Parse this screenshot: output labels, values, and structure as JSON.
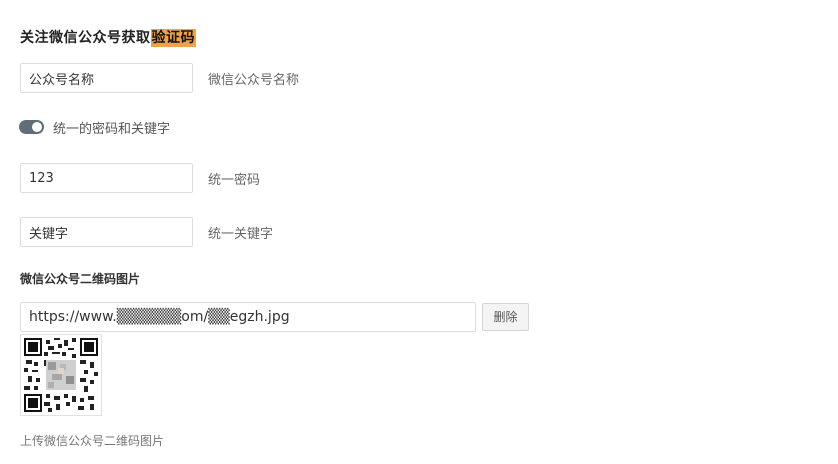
{
  "header": {
    "title_prefix": "关注微信公众号获取",
    "title_highlight": "验证码"
  },
  "fields": {
    "account_name": {
      "value": "公众号名称",
      "description": "微信公众号名称"
    },
    "unified_toggle": {
      "label": "统一的密码和关键字",
      "enabled": true
    },
    "password": {
      "value": "123",
      "description": "统一密码"
    },
    "keyword": {
      "value": "关键字",
      "description": "统一关键字"
    }
  },
  "qr_section": {
    "label": "微信公众号二维码图片",
    "url_value": "https://www.▒▒▒▒▒▒om/▒▒egzh.jpg",
    "delete_label": "删除",
    "upload_hint": "上传微信公众号二维码图片"
  },
  "colors": {
    "highlight": "#f0a24a",
    "toggle_on": "#5f6f7a",
    "border": "#dddddd"
  }
}
